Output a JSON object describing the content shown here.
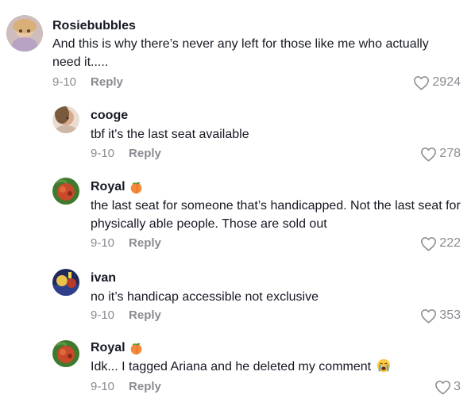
{
  "comments": [
    {
      "username": "Rosiebubbles",
      "text": "And this is why there’s never any left for those like me who actually need it.....",
      "date": "9-10",
      "reply_label": "Reply",
      "likes": "2924"
    },
    {
      "username": "cooge",
      "text": "tbf it's the last seat available",
      "date": "9-10",
      "reply_label": "Reply",
      "likes": "278"
    },
    {
      "username": "Royal",
      "text": "the last seat for someone that’s handicapped. Not the last seat for physically able people. Those are sold out",
      "date": "9-10",
      "reply_label": "Reply",
      "likes": "222"
    },
    {
      "username": "ivan",
      "text": "no it’s handicap accessible not exclusive",
      "date": "9-10",
      "reply_label": "Reply",
      "likes": "353"
    },
    {
      "username": "Royal",
      "text": "Idk... I tagged Ariana and he deleted my comment",
      "date": "9-10",
      "reply_label": "Reply",
      "likes": "3"
    }
  ],
  "icons": {
    "heart": "heart-outline-icon",
    "badge": "peach-emoji-icon",
    "emoji": "loudly-crying-face-emoji-icon"
  },
  "colors": {
    "text": "#161823",
    "muted": "#8a8b91",
    "peach": "#f4893a"
  }
}
